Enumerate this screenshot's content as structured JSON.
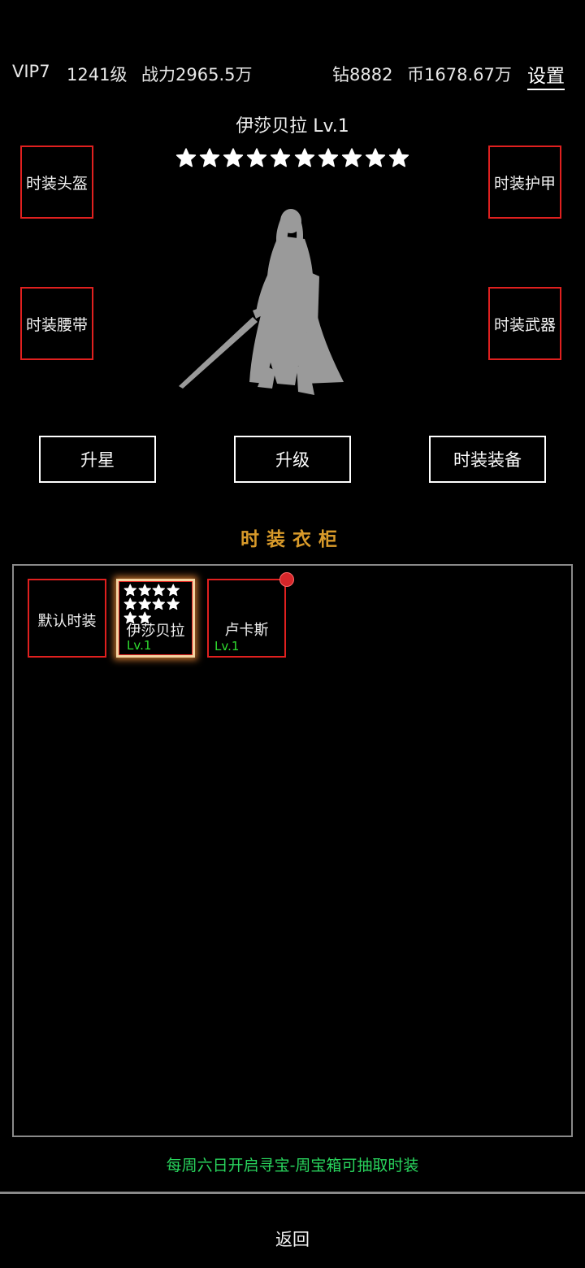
{
  "topbar": {
    "vip": "VIP7",
    "level": "1241级",
    "power": "战力2965.5万",
    "diamond": "钻8882",
    "coin": "币1678.67万",
    "settings": "设置"
  },
  "character": {
    "title": "伊莎贝拉 Lv.1",
    "stars_filled": 10,
    "stars_total": 10
  },
  "slots": {
    "helmet": "时装头盔",
    "armor": "时装护甲",
    "belt": "时装腰带",
    "weapon": "时装武器"
  },
  "actions": {
    "star_up": "升星",
    "level_up": "升级",
    "equip": "时装装备"
  },
  "wardrobe": {
    "title": "时装衣柜",
    "items": [
      {
        "name": "默认时装",
        "level": "",
        "selected": false,
        "badge": false,
        "stars": 0
      },
      {
        "name": "伊莎贝拉",
        "level": "Lv.1",
        "selected": true,
        "badge": false,
        "stars": 10
      },
      {
        "name": "卢卡斯",
        "level": "Lv.1",
        "selected": false,
        "badge": true,
        "stars": 0
      }
    ]
  },
  "notice": "每周六日开启寻宝-周宝箱可抽取时装",
  "footer": {
    "back": "返回"
  },
  "colors": {
    "background": "#000000",
    "slot_border": "#e0201f",
    "section_title": "#d89a2a",
    "level_text": "#2fdc2f",
    "notice": "#29d45d",
    "badge": "#d6262a"
  }
}
